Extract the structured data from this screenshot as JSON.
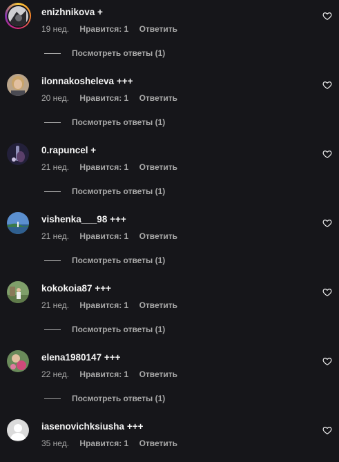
{
  "comments": [
    {
      "username": "enizhnikova",
      "text": "+",
      "age": "19 нед.",
      "likes": "Нравится: 1",
      "reply": "Ответить",
      "view_replies": "Посмотреть ответы (1)",
      "avatar": "story-avatar"
    },
    {
      "username": "ilonnakosheleva",
      "text": "+++",
      "age": "20 нед.",
      "likes": "Нравится: 1",
      "reply": "Ответить",
      "view_replies": "Посмотреть ответы (1)",
      "avatar": "portrait-avatar"
    },
    {
      "username": "0.rapuncel",
      "text": "+",
      "age": "21 нед.",
      "likes": "Нравится: 1",
      "reply": "Ответить",
      "view_replies": "Посмотреть ответы (1)",
      "avatar": "dark-avatar"
    },
    {
      "username": "vishenka___98",
      "text": "+++",
      "age": "21 нед.",
      "likes": "Нравится: 1",
      "reply": "Ответить",
      "view_replies": "Посмотреть ответы (1)",
      "avatar": "sky-avatar"
    },
    {
      "username": "kokokoia87",
      "text": "+++",
      "age": "21 нед.",
      "likes": "Нравится: 1",
      "reply": "Ответить",
      "view_replies": "Посмотреть ответы (1)",
      "avatar": "outdoor-avatar"
    },
    {
      "username": "elena1980147",
      "text": "+++",
      "age": "22 нед.",
      "likes": "Нравится: 1",
      "reply": "Ответить",
      "view_replies": "Посмотреть ответы (1)",
      "avatar": "flowers-avatar"
    },
    {
      "username": "iasenovichksiusha",
      "text": "+++",
      "age": "35 нед.",
      "likes": "Нравится: 1",
      "reply": "Ответить",
      "avatar": "default-avatar"
    }
  ],
  "colors": {
    "background": "#16161a",
    "primary_text": "#f5f5f5",
    "secondary_text": "#a8a8a8"
  }
}
